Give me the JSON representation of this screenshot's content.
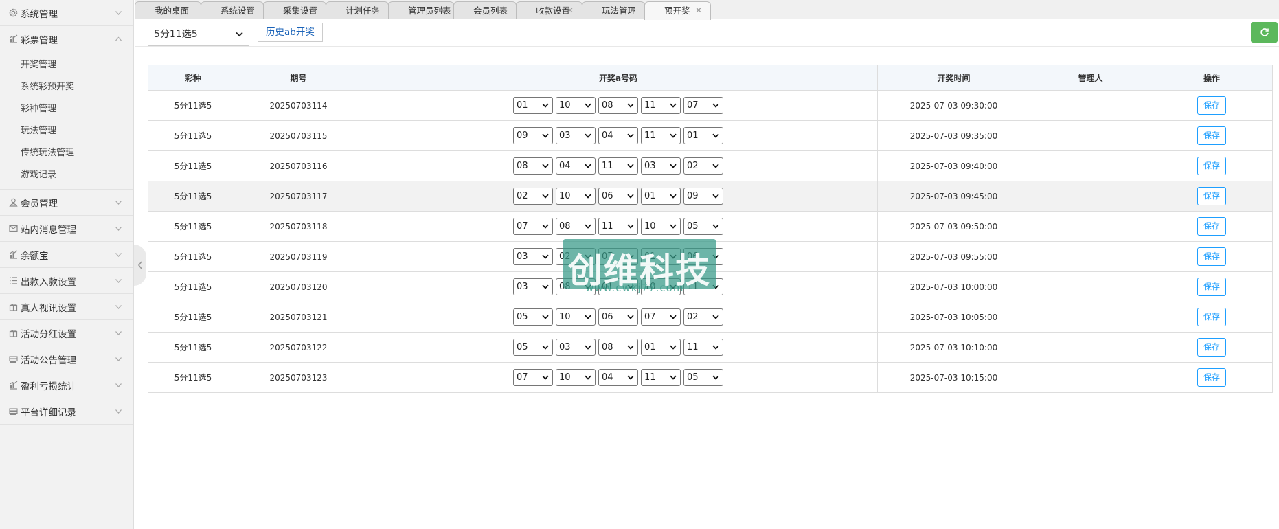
{
  "sidebar": {
    "groups": [
      {
        "label": "系统管理",
        "icon": "gear-icon",
        "expanded": false
      },
      {
        "label": "彩票管理",
        "icon": "chart-icon",
        "expanded": true,
        "items": [
          "开奖管理",
          "系统彩预开奖",
          "彩种管理",
          "玩法管理",
          "传统玩法管理",
          "游戏记录"
        ]
      },
      {
        "label": "会员管理",
        "icon": "user-icon",
        "expanded": false
      },
      {
        "label": "站内消息管理",
        "icon": "mail-icon",
        "expanded": false
      },
      {
        "label": "余额宝",
        "icon": "chart-icon",
        "expanded": false
      },
      {
        "label": "出款入款设置",
        "icon": "list-icon",
        "expanded": false
      },
      {
        "label": "真人视讯设置",
        "icon": "gift-icon",
        "expanded": false
      },
      {
        "label": "活动分红设置",
        "icon": "gift-icon",
        "expanded": false
      },
      {
        "label": "活动公告管理",
        "icon": "stack-icon",
        "expanded": false
      },
      {
        "label": "盈利亏损统计",
        "icon": "chart-icon",
        "expanded": false
      },
      {
        "label": "平台详细记录",
        "icon": "stack-icon",
        "expanded": false
      }
    ]
  },
  "tabs": [
    {
      "label": "我的桌面",
      "closable": false
    },
    {
      "label": "系统设置",
      "closable": true
    },
    {
      "label": "采集设置",
      "closable": true
    },
    {
      "label": "计划任务",
      "closable": true
    },
    {
      "label": "管理员列表",
      "closable": true
    },
    {
      "label": "会员列表",
      "closable": true
    },
    {
      "label": "收款设置",
      "closable": true
    },
    {
      "label": "玩法管理",
      "closable": true
    },
    {
      "label": "预开奖",
      "closable": true,
      "active": true
    }
  ],
  "toolbar": {
    "lottery_selected": "5分11选5",
    "history_button": "历史ab开奖",
    "accent_color": "#5cb85c"
  },
  "table": {
    "headers": [
      "彩种",
      "期号",
      "开奖a号码",
      "开奖时间",
      "管理人",
      "操作"
    ],
    "save_label": "保存",
    "rows": [
      {
        "lottery": "5分11选5",
        "issue": "20250703114",
        "nums": [
          "01",
          "10",
          "08",
          "11",
          "07"
        ],
        "time": "2025-07-03 09:30:00",
        "admin": ""
      },
      {
        "lottery": "5分11选5",
        "issue": "20250703115",
        "nums": [
          "09",
          "03",
          "04",
          "11",
          "01"
        ],
        "time": "2025-07-03 09:35:00",
        "admin": ""
      },
      {
        "lottery": "5分11选5",
        "issue": "20250703116",
        "nums": [
          "08",
          "04",
          "11",
          "03",
          "02"
        ],
        "time": "2025-07-03 09:40:00",
        "admin": ""
      },
      {
        "lottery": "5分11选5",
        "issue": "20250703117",
        "nums": [
          "02",
          "10",
          "06",
          "01",
          "09"
        ],
        "time": "2025-07-03 09:45:00",
        "admin": "",
        "highlight": true
      },
      {
        "lottery": "5分11选5",
        "issue": "20250703118",
        "nums": [
          "07",
          "08",
          "11",
          "10",
          "05"
        ],
        "time": "2025-07-03 09:50:00",
        "admin": ""
      },
      {
        "lottery": "5分11选5",
        "issue": "20250703119",
        "nums": [
          "03",
          "02",
          "07",
          "01",
          "06"
        ],
        "time": "2025-07-03 09:55:00",
        "admin": ""
      },
      {
        "lottery": "5分11选5",
        "issue": "20250703120",
        "nums": [
          "03",
          "08",
          "01",
          "10",
          "11"
        ],
        "time": "2025-07-03 10:00:00",
        "admin": ""
      },
      {
        "lottery": "5分11选5",
        "issue": "20250703121",
        "nums": [
          "05",
          "10",
          "06",
          "07",
          "02"
        ],
        "time": "2025-07-03 10:05:00",
        "admin": ""
      },
      {
        "lottery": "5分11选5",
        "issue": "20250703122",
        "nums": [
          "05",
          "03",
          "08",
          "01",
          "11"
        ],
        "time": "2025-07-03 10:10:00",
        "admin": ""
      },
      {
        "lottery": "5分11选5",
        "issue": "20250703123",
        "nums": [
          "07",
          "10",
          "04",
          "11",
          "05"
        ],
        "time": "2025-07-03 10:15:00",
        "admin": ""
      }
    ]
  },
  "watermark": {
    "text": "创维科技",
    "url": "www.cwkj77.com"
  }
}
